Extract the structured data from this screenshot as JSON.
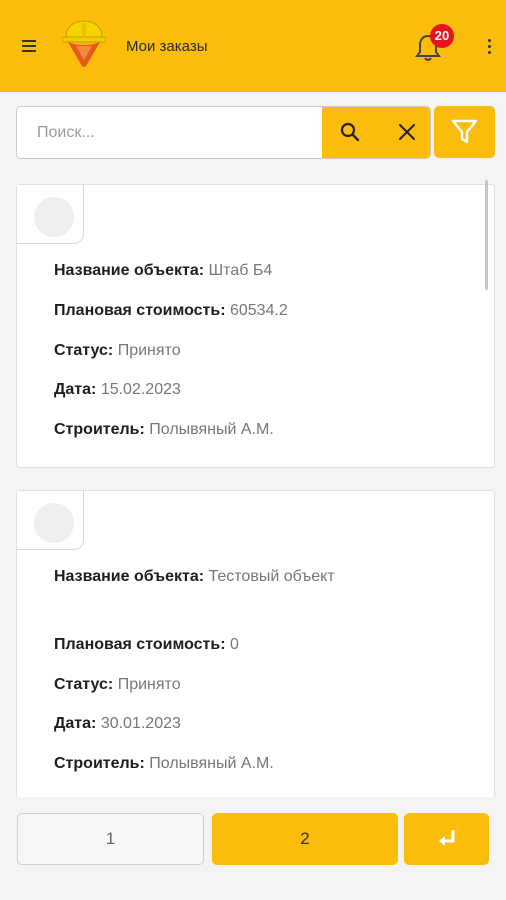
{
  "header": {
    "title": "Мои заказы",
    "notifications_count": "20",
    "menu_icon": "hamburger-icon",
    "bell_icon": "bell-icon",
    "more_icon": "kebab-icon"
  },
  "search": {
    "placeholder": "Поиск...",
    "value": "",
    "search_icon": "search-icon",
    "clear_icon": "close-icon",
    "filter_icon": "filter-icon"
  },
  "labels": {
    "name": "Название объекта:",
    "cost": "Плановая стоимость:",
    "status": "Статус:",
    "date": "Дата:",
    "builder": "Строитель:"
  },
  "orders": [
    {
      "name": "Штаб Б4",
      "cost": "60534.2",
      "status": "Принято",
      "date": "15.02.2023",
      "builder": "Полывяный А.М."
    },
    {
      "name": "Тестовый объект",
      "cost": "0",
      "status": "Принято",
      "date": "30.01.2023",
      "builder": "Полывяный А.М."
    }
  ],
  "pagination": {
    "pages": [
      "1",
      "2"
    ],
    "current": "2",
    "enter_icon": "enter-arrow-icon"
  },
  "colors": {
    "accent": "#fcbc0b",
    "badge": "#e3151e",
    "background": "#f4f4f4"
  }
}
